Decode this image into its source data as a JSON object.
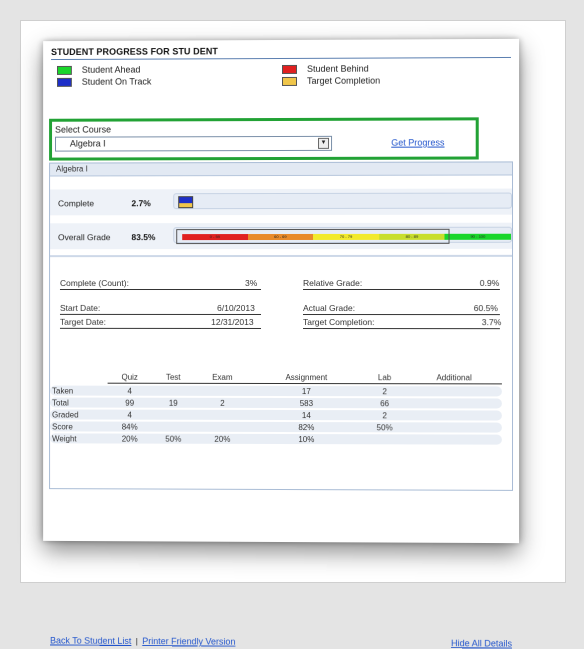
{
  "title": "STUDENT PROGRESS FOR STU DENT",
  "legend": [
    {
      "label": "Student Ahead",
      "color": "#19d62b"
    },
    {
      "label": "Student Behind",
      "color": "#e02020"
    },
    {
      "label": "Student On Track",
      "color": "#1d2fc8"
    },
    {
      "label": "Target Completion",
      "color": "#f0c64a"
    }
  ],
  "course": {
    "label": "Select Course",
    "selected": "Algebra I",
    "get_progress": "Get Progress"
  },
  "panel": {
    "header": "Algebra I",
    "complete_label": "Complete",
    "complete_value": "2.7%",
    "complete_fraction": 0.027,
    "grade_label": "Overall Grade",
    "grade_value": "83.5%",
    "grade_fraction": 0.835,
    "grade_bands": [
      {
        "text": "0 - 59",
        "color": "#e02020"
      },
      {
        "text": "60 - 69",
        "color": "#e88a2a"
      },
      {
        "text": "70 - 79",
        "color": "#f2ea2c"
      },
      {
        "text": "80 - 89",
        "color": "#c8de2c"
      },
      {
        "text": "90 - 100",
        "color": "#19d62b"
      }
    ]
  },
  "details": {
    "complete_count_label": "Complete (Count):",
    "complete_count_value": "3%",
    "relative_grade_label": "Relative Grade:",
    "relative_grade_value": "0.9%",
    "start_date_label": "Start Date:",
    "start_date_value": "6/10/2013",
    "actual_grade_label": "Actual Grade:",
    "actual_grade_value": "60.5%",
    "target_date_label": "Target Date:",
    "target_date_value": "12/31/2013",
    "target_completion_label": "Target Completion:",
    "target_completion_value": "3.7%"
  },
  "table": {
    "columns": [
      "Quiz",
      "Test",
      "Exam",
      "Assignment",
      "Lab",
      "Additional"
    ],
    "rows": [
      {
        "label": "Taken",
        "cells": [
          "4",
          "",
          "",
          "17",
          "2",
          ""
        ]
      },
      {
        "label": "Total",
        "cells": [
          "99",
          "19",
          "2",
          "583",
          "66",
          ""
        ]
      },
      {
        "label": "Graded",
        "cells": [
          "4",
          "",
          "",
          "14",
          "2",
          ""
        ]
      },
      {
        "label": "Score",
        "cells": [
          "84%",
          "",
          "",
          "82%",
          "50%",
          ""
        ]
      },
      {
        "label": "Weight",
        "cells": [
          "20%",
          "50%",
          "20%",
          "10%",
          "",
          ""
        ]
      }
    ]
  },
  "footer": {
    "back": "Back To Student List",
    "sep": "|",
    "printer": "Printer Friendly Version",
    "hide": "Hide All Details"
  }
}
